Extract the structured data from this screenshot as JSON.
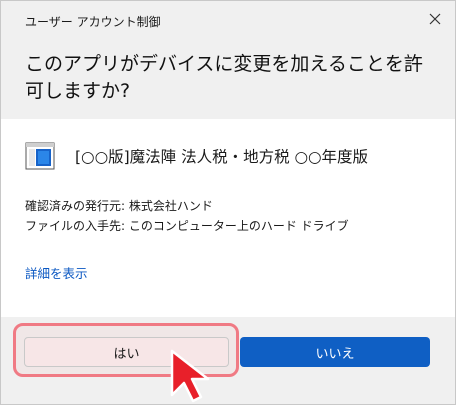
{
  "dialog": {
    "title": "ユーザー アカウント制御",
    "question": "このアプリがデバイスに変更を加えることを許可しますか?",
    "app_name": "[○○版]魔法陣 法人税・地方税 ○○年度版",
    "publisher": "確認済みの発行元: 株式会社ハンド",
    "file_origin": "ファイルの入手先: このコンピューター上のハード ドライブ",
    "details_link": "詳細を表示",
    "yes_label": "はい",
    "no_label": "いいえ"
  },
  "colors": {
    "header_bg": "#f0f0f0",
    "link": "#0a57c2",
    "primary_button": "#0f5fc4",
    "highlight": "#f07a84"
  },
  "icons": {
    "close": "close-icon",
    "app": "app-window-icon",
    "pointer": "red-arrow-pointer-icon"
  }
}
